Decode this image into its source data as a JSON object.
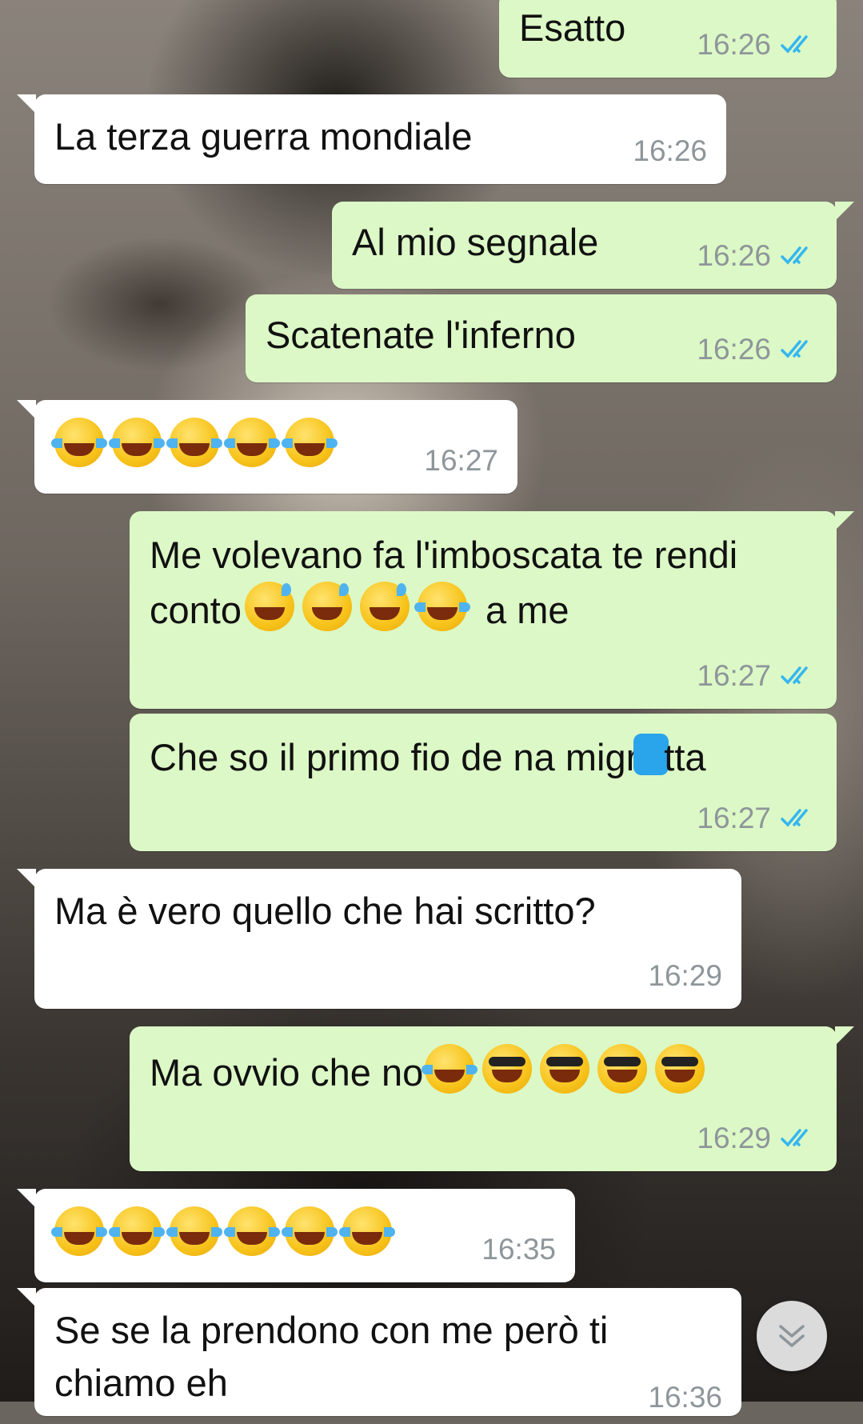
{
  "messages": [
    {
      "id": "m1",
      "direction": "outgoing",
      "text": "Esatto",
      "time": "16:26",
      "read": true
    },
    {
      "id": "m2",
      "direction": "incoming",
      "text": "La terza guerra mondiale",
      "time": "16:26"
    },
    {
      "id": "m3",
      "direction": "outgoing",
      "text": "Al mio segnale",
      "time": "16:26",
      "read": true
    },
    {
      "id": "m4",
      "direction": "outgoing",
      "text": "Scatenate l'inferno",
      "time": "16:26",
      "read": true
    },
    {
      "id": "m5",
      "direction": "incoming",
      "emoji": [
        "face-with-tears-of-joy",
        "face-with-tears-of-joy",
        "face-with-tears-of-joy",
        "face-with-tears-of-joy",
        "face-with-tears-of-joy"
      ],
      "time": "16:27"
    },
    {
      "id": "m6",
      "direction": "outgoing",
      "text_before": "Me volevano fa l'imboscata te rendi conto",
      "emoji": [
        "grinning-face-with-sweat",
        "grinning-face-with-sweat",
        "grinning-face-with-sweat",
        "face-with-tears-of-joy"
      ],
      "text_after": " a me",
      "time": "16:27",
      "read": true
    },
    {
      "id": "m7",
      "direction": "outgoing",
      "text_before": "Che so il primo fio de na migr",
      "text_after": "tta",
      "time": "16:27",
      "read": true
    },
    {
      "id": "m8",
      "direction": "incoming",
      "text": "Ma è vero quello che hai scritto?",
      "time": "16:29"
    },
    {
      "id": "m9",
      "direction": "outgoing",
      "text_before": "Ma ovvio che no",
      "emoji": [
        "face-with-tears-of-joy",
        "smiling-face-with-sunglasses",
        "smiling-face-with-sunglasses",
        "smiling-face-with-sunglasses",
        "smiling-face-with-sunglasses"
      ],
      "time": "16:29",
      "read": true
    },
    {
      "id": "m10",
      "direction": "incoming",
      "emoji": [
        "face-with-tears-of-joy",
        "face-with-tears-of-joy",
        "face-with-tears-of-joy",
        "face-with-tears-of-joy",
        "face-with-tears-of-joy",
        "face-with-tears-of-joy"
      ],
      "time": "16:35"
    },
    {
      "id": "m11",
      "direction": "incoming",
      "text": "Se se la prendono con me però ti chiamo eh",
      "time": "16:36"
    }
  ],
  "colors": {
    "incoming_bubble": "#ffffff",
    "outgoing_bubble": "#dcf8c6",
    "timestamp": "#8e969a",
    "read_ticks": "#34b7f1",
    "redaction": "#2aa4ea"
  },
  "icons": {
    "read_receipt": "double-check-icon",
    "scroll_down": "double-chevron-down-icon"
  }
}
